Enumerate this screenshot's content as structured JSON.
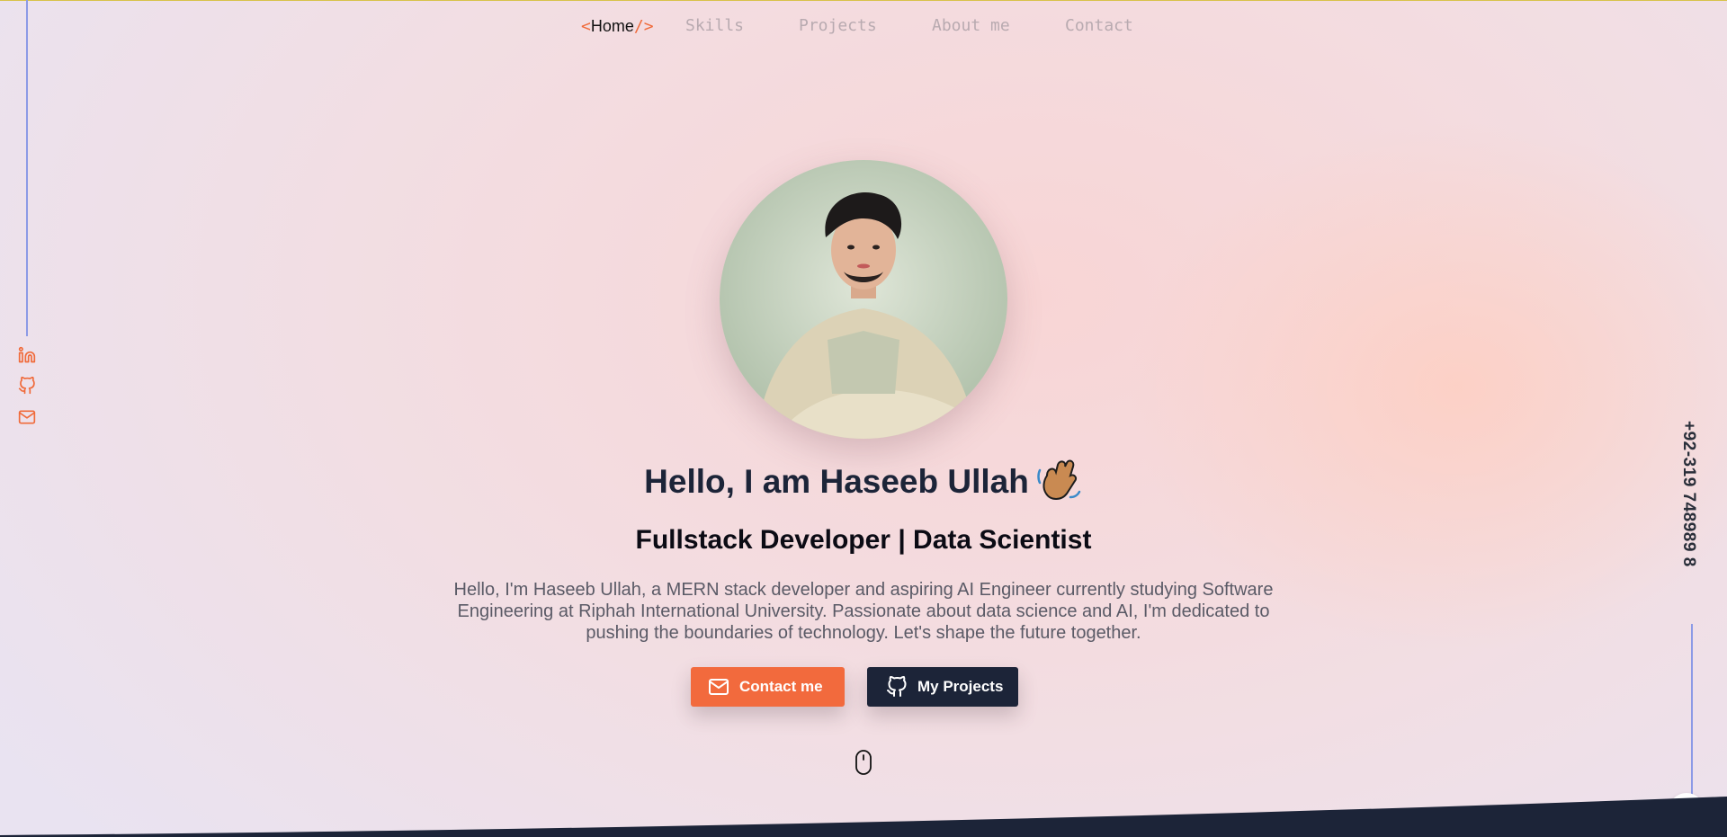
{
  "nav": {
    "home_open": "<",
    "home_label": "Home",
    "home_close": "/>",
    "items": [
      "Skills",
      "Projects",
      "About me",
      "Contact"
    ]
  },
  "social": {
    "icons": [
      "linkedin-icon",
      "github-icon",
      "mail-icon"
    ],
    "accent": "#f06a3a"
  },
  "side": {
    "phone": "+92-319 748989 8"
  },
  "hero": {
    "title": "Hello, I am Haseeb Ullah",
    "subtitle": "Fullstack Developer | Data Scientist",
    "description": "Hello, I'm Haseeb Ullah, a MERN stack developer and aspiring AI Engineer currently studying Software Engineering at Riphah International University. Passionate about data science and AI, I'm dedicated to pushing the boundaries of technology. Let's shape the future together.",
    "contact_button": "Contact me",
    "projects_button": "My Projects"
  },
  "colors": {
    "accent": "#f26a3d",
    "dark": "#1c2438",
    "rail": "#8c9ae6"
  }
}
